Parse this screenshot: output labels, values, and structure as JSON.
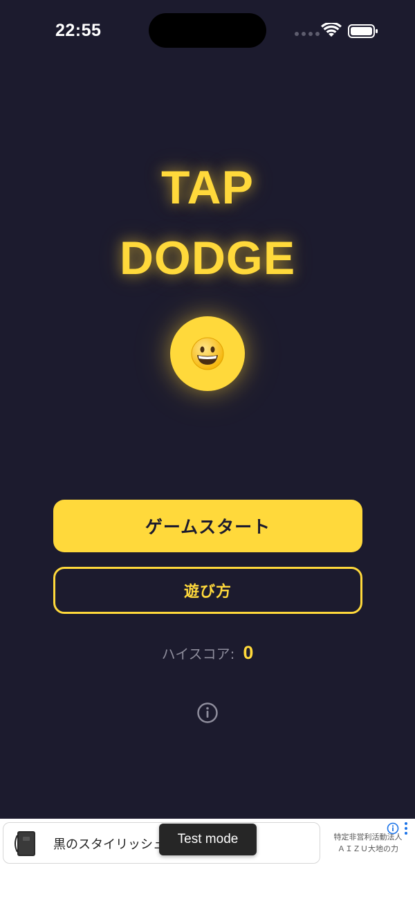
{
  "status_bar": {
    "time": "22:55"
  },
  "title": {
    "line1": "TAP",
    "line2": "DODGE"
  },
  "player": {
    "icon": "grinning-face-icon"
  },
  "buttons": {
    "start": "ゲームスタート",
    "how_to_play": "遊び方"
  },
  "high_score": {
    "label": "ハイスコア:",
    "value": "0"
  },
  "ad": {
    "headline": "黒のスタイリッシュ",
    "advertiser_line1": "特定非営利活動法人",
    "advertiser_line2": "ＡＩＺＵ大地の力",
    "toast": "Test mode"
  },
  "colors": {
    "background": "#1c1b2e",
    "accent": "#ffd93b",
    "muted": "#8e8d9c"
  }
}
